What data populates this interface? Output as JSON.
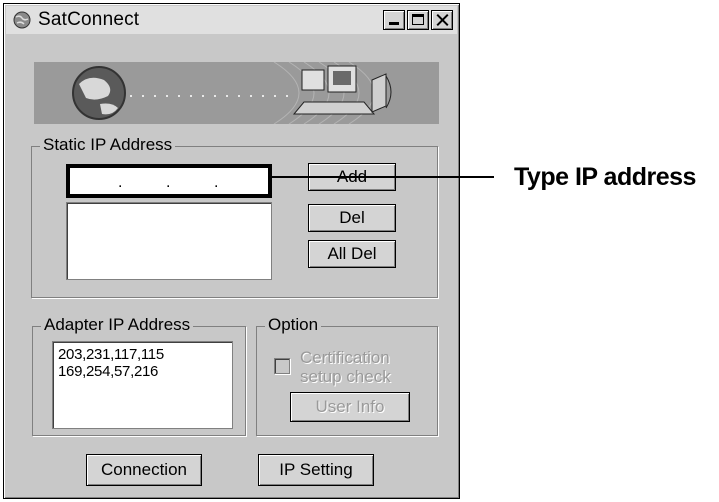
{
  "window": {
    "title": "SatConnect",
    "icons": {
      "app": "satellite-globe-icon",
      "minimize": "minimize-icon",
      "maximize": "maximize-icon",
      "close": "close-icon"
    }
  },
  "banner": {
    "icons": [
      "globe-icon",
      "computer-network-icon"
    ]
  },
  "static_ip": {
    "group_label": "Static IP Address",
    "ip_dots": [
      ".",
      ".",
      "."
    ],
    "list_items": [],
    "add_label": "Add",
    "del_label": "Del",
    "all_del_label": "All Del"
  },
  "adapter_ip": {
    "group_label": "Adapter IP Address",
    "addresses": "203,231,117,115\n169,254,57,216"
  },
  "option": {
    "group_label": "Option",
    "certification_label": "Certification\nsetup check",
    "certification_checked": false,
    "user_info_label": "User Info"
  },
  "footer": {
    "connection_label": "Connection",
    "ip_setting_label": "IP Setting"
  },
  "callout": {
    "text": "Type IP address"
  },
  "colors": {
    "window_bg": "#c8c8c8",
    "disabled_text": "#9a9a9a",
    "field_bg": "#ffffff"
  }
}
